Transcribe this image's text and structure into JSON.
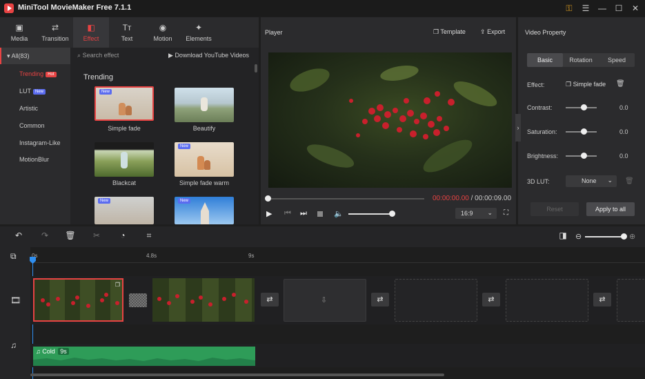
{
  "app": {
    "title": "MiniTool MovieMaker Free 7.1.1"
  },
  "toolbar": {
    "tabs": [
      {
        "label": "Media",
        "icon": "media-icon"
      },
      {
        "label": "Transition",
        "icon": "transition-icon"
      },
      {
        "label": "Effect",
        "icon": "effect-icon",
        "active": true
      },
      {
        "label": "Text",
        "icon": "text-icon"
      },
      {
        "label": "Motion",
        "icon": "motion-icon"
      },
      {
        "label": "Elements",
        "icon": "elements-icon"
      }
    ]
  },
  "categories": {
    "all": "All(83)",
    "items": [
      {
        "label": "Trending",
        "badge": "Hot",
        "active": true
      },
      {
        "label": "LUT",
        "badge": "New"
      },
      {
        "label": "Artistic"
      },
      {
        "label": "Common"
      },
      {
        "label": "Instagram-Like"
      },
      {
        "label": "MotionBlur"
      }
    ]
  },
  "effects": {
    "search_placeholder": "Search effect",
    "download_label": "Download YouTube Videos",
    "section_title": "Trending",
    "items": [
      {
        "label": "Simple fade",
        "badge": "New",
        "selected": true
      },
      {
        "label": "Beautify"
      },
      {
        "label": "Blackcat"
      },
      {
        "label": "Simple fade warm",
        "badge": "New"
      },
      {
        "label": "",
        "badge": "New"
      },
      {
        "label": "",
        "badge": "New"
      }
    ]
  },
  "player": {
    "title": "Player",
    "template_label": "Template",
    "export_label": "Export",
    "current_time": "00:00:00.00",
    "separator": " / ",
    "total_time": "00:00:09.00",
    "aspect": "16:9",
    "volume_fraction": 0.85
  },
  "property": {
    "title": "Video Property",
    "tabs": [
      "Basic",
      "Rotation",
      "Speed"
    ],
    "effect_label": "Effect:",
    "effect_value": "Simple fade",
    "contrast_label": "Contrast:",
    "contrast_value": "0.0",
    "saturation_label": "Saturation:",
    "saturation_value": "0.0",
    "brightness_label": "Brightness:",
    "brightness_value": "0.0",
    "lut_label": "3D LUT:",
    "lut_value": "None",
    "reset_label": "Reset",
    "apply_label": "Apply to all"
  },
  "timeline": {
    "ruler": [
      "0s",
      "4.8s",
      "9s"
    ],
    "audio_label": "Cold",
    "audio_duration": "9s",
    "zoom_fraction": 0.95
  },
  "colors": {
    "accent": "#e84343",
    "audio": "#2e9c58",
    "new_badge": "#5b6cf0"
  }
}
